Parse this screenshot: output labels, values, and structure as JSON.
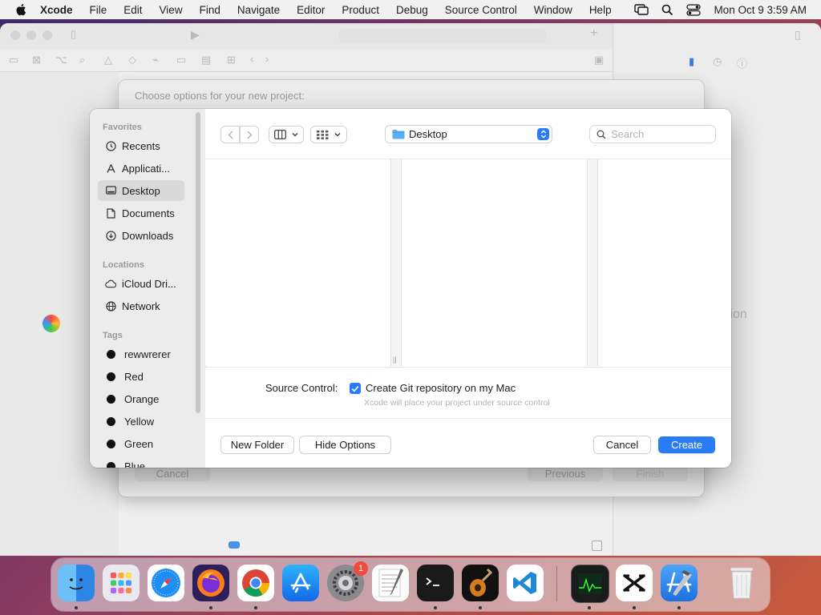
{
  "menubar": {
    "app_name": "Xcode",
    "items": [
      "File",
      "Edit",
      "View",
      "Find",
      "Navigate",
      "Editor",
      "Product",
      "Debug",
      "Source Control",
      "Window",
      "Help"
    ],
    "clock": "Mon Oct 9  3:59 AM"
  },
  "project_sheet": {
    "header": "Choose options for your new project:",
    "cancel_label": "Cancel",
    "previous_label": "Previous",
    "finish_label": "Finish"
  },
  "inspector": {
    "partial_text": "tion"
  },
  "sidebar": {
    "favorites_title": "Favorites",
    "favorites": [
      {
        "label": "Recents",
        "icon": "clock-icon"
      },
      {
        "label": "Applicati...",
        "icon": "applications-icon"
      },
      {
        "label": "Desktop",
        "icon": "desktop-icon",
        "selected": true
      },
      {
        "label": "Documents",
        "icon": "document-icon"
      },
      {
        "label": "Downloads",
        "icon": "download-icon"
      }
    ],
    "locations_title": "Locations",
    "locations": [
      {
        "label": "iCloud Dri...",
        "icon": "cloud-icon"
      },
      {
        "label": "Network",
        "icon": "globe-icon"
      }
    ],
    "tags_title": "Tags",
    "tags": [
      {
        "label": "rewwrerer"
      },
      {
        "label": "Red"
      },
      {
        "label": "Orange"
      },
      {
        "label": "Yellow"
      },
      {
        "label": "Green"
      },
      {
        "label": "Blue"
      }
    ]
  },
  "toolbar": {
    "location": "Desktop",
    "search_placeholder": "Search"
  },
  "options": {
    "source_control_label": "Source Control:",
    "git_checkbox_label": "Create Git repository on my Mac",
    "git_checked": true,
    "hint": "Xcode will place your project under source control"
  },
  "footer": {
    "new_folder": "New Folder",
    "hide_options": "Hide Options",
    "cancel": "Cancel",
    "create": "Create"
  },
  "dock": {
    "apps": [
      "Finder",
      "Launchpad",
      "Safari",
      "Firefox",
      "Chrome",
      "App Store",
      "System Settings",
      "TextEdit",
      "Terminal",
      "GarageBand",
      "Visual Studio Code",
      "Activity Monitor",
      "CapCut",
      "Xcode",
      "Trash"
    ],
    "settings_badge": "1"
  },
  "colors": {
    "accent": "#2a7cf6",
    "selection": "#d9d9d9"
  }
}
